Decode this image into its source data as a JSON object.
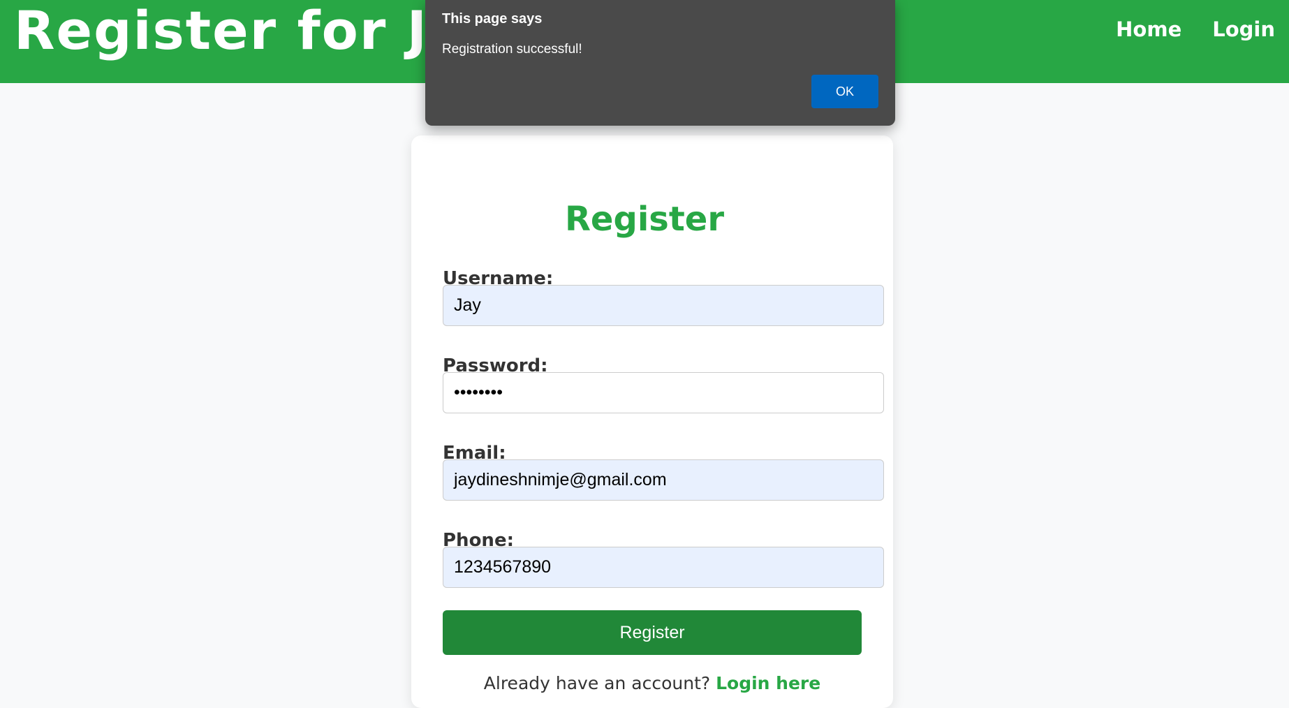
{
  "header": {
    "brand": "Register for Jay",
    "nav": [
      "Home",
      "Login"
    ]
  },
  "form": {
    "title": "Register",
    "username_label": "Username:",
    "username_value": "Jay",
    "password_label": "Password:",
    "password_value": "••••••••",
    "email_label": "Email:",
    "email_value": "jaydineshnimje@gmail.com",
    "phone_label": "Phone:",
    "phone_value": "1234567890",
    "submit_label": "Register",
    "login_prompt": "Already have an account?",
    "login_link": "Login here"
  },
  "dialog": {
    "title": "This page says",
    "message": "Registration successful!",
    "ok_label": "OK"
  },
  "colors": {
    "header_bg": "#28a745",
    "accent": "#28a745",
    "button_bg": "#218838",
    "dialog_bg": "#4a4a4a",
    "dialog_button": "#0067c0",
    "autofill_bg": "#e8f0fe"
  }
}
